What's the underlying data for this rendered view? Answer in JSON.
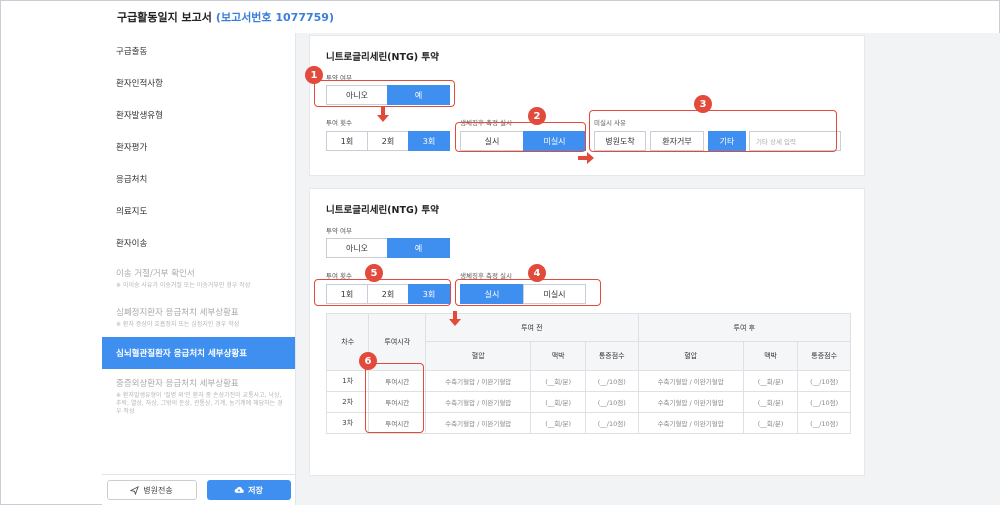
{
  "header": {
    "title": "구급활동일지 보고서",
    "report_number": "(보고서번호 1077759)"
  },
  "sidebar": {
    "items": [
      {
        "label": "구급출동"
      },
      {
        "label": "환자인적사항"
      },
      {
        "label": "환자발생유형"
      },
      {
        "label": "환자평가"
      },
      {
        "label": "응급처치"
      },
      {
        "label": "의료지도"
      },
      {
        "label": "환자이송"
      },
      {
        "label": "이송 거절/거부 확인서",
        "sub": "※ 이이송 사유가 이송거절 또는 이송거부인 경우 작성"
      },
      {
        "label": "심폐정지환자 응급처치 세부상황표",
        "sub": "※ 환자 증상이 호흡정지 또는 심정지인 경우 작성"
      },
      {
        "label": "심뇌혈관질환자 응급처치 세부상황표"
      },
      {
        "label": "중증외상환자 응급처치 세부상황표",
        "sub": "※ 환자발생유형이 '질병 외'인 환자 중 손상기전이 교통사고, 낙상, 추락, 열상, 자상, 그밖의 둔상, 관통상, 기계, 농기계에 해당하는 경우 작성"
      }
    ],
    "footer": {
      "hospital_button": "병원전송",
      "save_button": "저장"
    }
  },
  "card1": {
    "title": "니트로글리세린(NTG) 투약",
    "admin_label": "투약 여부",
    "admin_options": [
      "아니오",
      "예"
    ],
    "count_label": "투여 횟수",
    "count_options": [
      "1회",
      "2회",
      "3회"
    ],
    "measure_label": "생체징후 측정 실시",
    "measure_options": [
      "실시",
      "미실시"
    ],
    "reason_label": "미실시 사유",
    "reason_options": [
      "병원도착",
      "환자거부",
      "기타"
    ],
    "reason_placeholder": "기타 상세 입력"
  },
  "card2": {
    "title": "니트로글리세린(NTG) 투약",
    "admin_label": "투약 여부",
    "admin_options": [
      "아니오",
      "예"
    ],
    "count_label": "투여 횟수",
    "count_options": [
      "1회",
      "2회",
      "3회"
    ],
    "measure_label": "생체징후 측정 실시",
    "measure_options": [
      "실시",
      "미실시"
    ],
    "table": {
      "h_round": "차수",
      "h_time": "투여시각",
      "h_before": "투여 전",
      "h_after": "투여 후",
      "h_bp": "혈압",
      "h_pulse": "맥박",
      "h_pain": "통증점수",
      "rows": [
        {
          "round": "1차",
          "time": "투여시간",
          "bp": "수축기혈압   /   이완기혈압",
          "pulse": "(__회/분)",
          "pain": "(__/10점)"
        },
        {
          "round": "2차",
          "time": "투여시간",
          "bp": "수축기혈압   /   이완기혈압",
          "pulse": "(__회/분)",
          "pain": "(__/10점)"
        },
        {
          "round": "3차",
          "time": "투여시간",
          "bp": "수축기혈압   /   이완기혈압",
          "pulse": "(__회/분)",
          "pain": "(__/10점)"
        }
      ]
    }
  },
  "badges": [
    "1",
    "2",
    "3",
    "4",
    "5",
    "6"
  ],
  "colors": {
    "accent": "#3f8ff0",
    "annotation": "#e24b3b"
  }
}
